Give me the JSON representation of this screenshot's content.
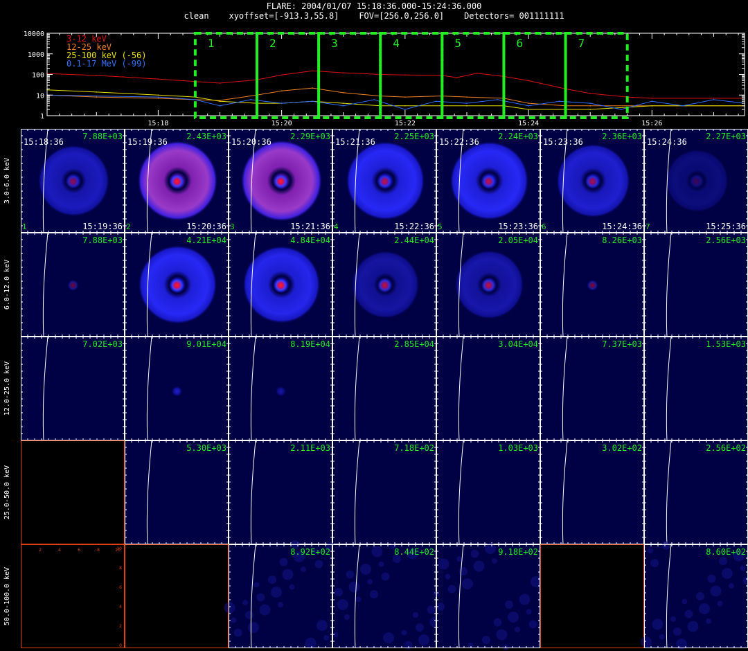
{
  "header": {
    "title": "FLARE: 2004/01/07 15:18:36.000-15:24:36.000",
    "clean": "clean",
    "xyoffset": "xyoffset=[-913.3,55.8]",
    "fov": "FOV=[256.0,256.0]",
    "detectors": "Detectors= 001111111"
  },
  "colors": {
    "band_3_12": "#e01010",
    "band_12_25": "#f08020",
    "band_25_100": "#e8e000",
    "band_01_17": "#3070ff",
    "box": "#22ee22",
    "label_green": "#22ee22"
  },
  "chart_data": [
    {
      "type": "line",
      "title": "",
      "ylog": true,
      "ylim": [
        1,
        10000
      ],
      "yticks": [
        "10000",
        "1000",
        "100",
        "10",
        "1"
      ],
      "xlim": [
        "15:16:12",
        "15:27:30"
      ],
      "xticks": [
        "15:18",
        "15:20",
        "15:22",
        "15:24",
        "15:26"
      ],
      "legend_placement": "top-left",
      "intervals": [
        {
          "label": "1",
          "start": "15:18:36",
          "end": "15:19:36"
        },
        {
          "label": "2",
          "start": "15:19:36",
          "end": "15:20:36"
        },
        {
          "label": "3",
          "start": "15:20:36",
          "end": "15:21:36"
        },
        {
          "label": "4",
          "start": "15:21:36",
          "end": "15:22:36"
        },
        {
          "label": "5",
          "start": "15:22:36",
          "end": "15:23:36"
        },
        {
          "label": "6",
          "start": "15:23:36",
          "end": "15:24:36"
        },
        {
          "label": "7",
          "start": "15:24:36",
          "end": "15:25:36"
        }
      ],
      "series": [
        {
          "name": "3-12 keV",
          "color": "#e01010",
          "x": [
            "15:16:12",
            "15:17:00",
            "15:18:00",
            "15:18:36",
            "15:19:00",
            "15:19:36",
            "15:20:00",
            "15:20:30",
            "15:21:00",
            "15:21:36",
            "15:22:00",
            "15:22:36",
            "15:22:50",
            "15:23:10",
            "15:23:36",
            "15:24:00",
            "15:24:36",
            "15:25:00",
            "15:25:36",
            "15:26:00",
            "15:27:00",
            "15:27:30"
          ],
          "y": [
            110,
            90,
            60,
            45,
            38,
            55,
            95,
            150,
            120,
            100,
            95,
            90,
            70,
            115,
            80,
            50,
            20,
            12,
            8,
            7,
            7,
            7
          ]
        },
        {
          "name": "12-25 keV",
          "color": "#f08020",
          "x": [
            "15:16:12",
            "15:17:00",
            "15:18:00",
            "15:18:36",
            "15:19:00",
            "15:19:36",
            "15:20:00",
            "15:20:30",
            "15:21:00",
            "15:21:36",
            "15:22:00",
            "15:22:36",
            "15:23:00",
            "15:23:36",
            "15:24:00",
            "15:24:36",
            "15:25:00",
            "15:26:00",
            "15:27:30"
          ],
          "y": [
            10,
            8,
            7,
            6,
            5.5,
            10,
            16,
            22,
            13,
            9,
            8,
            9,
            8,
            7,
            4,
            3,
            3,
            3,
            3
          ]
        },
        {
          "name": "25-100 keV (-56)",
          "color": "#e8e000",
          "x": [
            "15:16:12",
            "15:17:00",
            "15:18:00",
            "15:18:36",
            "15:19:00",
            "15:19:36",
            "15:20:00",
            "15:20:30",
            "15:21:00",
            "15:21:36",
            "15:22:00",
            "15:22:36",
            "15:23:00",
            "15:23:36",
            "15:24:00",
            "15:24:36",
            "15:25:00",
            "15:26:00",
            "15:27:30"
          ],
          "y": [
            18,
            14,
            10,
            8,
            5,
            4,
            4,
            5,
            4,
            3,
            3,
            3,
            3,
            3,
            2,
            2,
            2,
            3,
            3
          ]
        },
        {
          "name": "0.1-17 MeV (-99)",
          "color": "#3070ff",
          "x": [
            "15:16:12",
            "15:17:00",
            "15:18:00",
            "15:18:36",
            "15:19:00",
            "15:19:30",
            "15:20:00",
            "15:20:30",
            "15:21:00",
            "15:21:30",
            "15:22:00",
            "15:22:30",
            "15:23:00",
            "15:23:30",
            "15:24:00",
            "15:24:30",
            "15:25:00",
            "15:25:30",
            "15:26:00",
            "15:26:30",
            "15:27:00",
            "15:27:30"
          ],
          "y": [
            10,
            9,
            8,
            6,
            3,
            6,
            4,
            5,
            3,
            6,
            2,
            5,
            4,
            6,
            3,
            5,
            4,
            2,
            5,
            3,
            6,
            4
          ]
        }
      ]
    },
    {
      "type": "heatmap",
      "title": "",
      "columns": [
        {
          "start": "15:18:36",
          "end": "15:19:36",
          "index": "1"
        },
        {
          "start": "15:19:36",
          "end": "15:20:36",
          "index": "2"
        },
        {
          "start": "15:20:36",
          "end": "15:21:36",
          "index": "3"
        },
        {
          "start": "15:21:36",
          "end": "15:22:36",
          "index": "4"
        },
        {
          "start": "15:22:36",
          "end": "15:23:36",
          "index": "5"
        },
        {
          "start": "15:23:36",
          "end": "15:24:36",
          "index": "6"
        },
        {
          "start": "15:24:36",
          "end": "15:25:36",
          "index": "7"
        }
      ],
      "rows": [
        {
          "label": "3.0-6.0 keV",
          "peaks": [
            "7.88E+03",
            "2.43E+03",
            "2.29E+03",
            "2.25E+03",
            "2.24E+03",
            "2.36E+03",
            "2.27E+03"
          ],
          "ring": [
            0.55,
            0.9,
            0.95,
            0.85,
            0.85,
            0.65,
            0.2
          ],
          "ring_red": [
            0,
            0.55,
            0.75,
            0,
            0,
            0,
            0
          ],
          "core": [
            0.5,
            1,
            1,
            0.7,
            0.7,
            0.6,
            0.2
          ]
        },
        {
          "label": "6.0-12.0 keV",
          "peaks": [
            "7.88E+03",
            "4.21E+04",
            "4.84E+04",
            "2.44E+04",
            "2.05E+04",
            "8.26E+03",
            "2.56E+03"
          ],
          "ring": [
            0,
            0.85,
            0.8,
            0.4,
            0.45,
            0,
            0
          ],
          "ring_red": [
            0,
            0,
            0,
            0,
            0,
            0,
            0
          ],
          "core": [
            0.4,
            1,
            1,
            0.7,
            0.7,
            0.45,
            0
          ]
        },
        {
          "label": "12.0-25.0 keV",
          "peaks": [
            "7.02E+03",
            "9.01E+04",
            "8.19E+04",
            "2.85E+04",
            "3.04E+04",
            "7.37E+03",
            "1.53E+03"
          ],
          "ring": [
            0,
            0,
            0,
            0,
            0,
            0,
            0
          ],
          "ring_red": [
            0,
            0,
            0,
            0,
            0,
            0,
            0
          ],
          "core": [
            0,
            0.7,
            0.5,
            0,
            0,
            0,
            0
          ]
        },
        {
          "label": "25.0-50.0 keV",
          "peaks": [
            "",
            "5.30E+03",
            "2.11E+03",
            "7.18E+02",
            "1.03E+03",
            "3.02E+02",
            "2.56E+02"
          ],
          "ring": [
            0,
            0,
            0,
            0,
            0,
            0,
            0
          ],
          "ring_red": [
            0,
            0,
            0,
            0,
            0,
            0,
            0
          ],
          "core": [
            0,
            0,
            0,
            0,
            0,
            0,
            0
          ],
          "empty": [
            true,
            false,
            false,
            false,
            false,
            false,
            false
          ]
        },
        {
          "label": "50.0-100.0 keV",
          "peaks": [
            "",
            "",
            "8.92E+02",
            "8.44E+02",
            "9.18E+02",
            "",
            "8.60E+02"
          ],
          "ring": [
            0,
            0,
            0,
            0,
            0,
            0,
            0
          ],
          "ring_red": [
            0,
            0,
            0,
            0,
            0,
            0,
            0
          ],
          "core": [
            0,
            0,
            0,
            0,
            0,
            0,
            0
          ],
          "empty": [
            true,
            true,
            false,
            false,
            false,
            true,
            false
          ],
          "noise": [
            false,
            false,
            true,
            true,
            true,
            false,
            true
          ],
          "empty_axes_ticks_x": [
            "2",
            "4",
            "6",
            "8",
            "10"
          ],
          "empty_axes_ticks_y": [
            "0",
            "2",
            "4",
            "6",
            "8",
            "10"
          ]
        }
      ]
    }
  ]
}
